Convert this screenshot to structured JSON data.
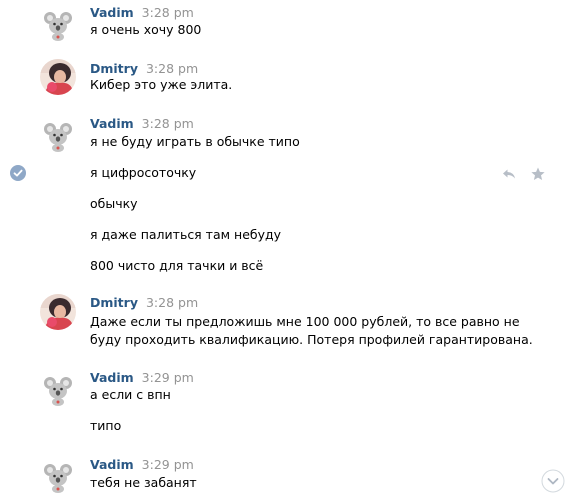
{
  "messages": [
    {
      "author": "Vadim",
      "time": "3:28 pm",
      "avatar": "koala-avatar",
      "lines": [
        "я очень хочу 800"
      ]
    },
    {
      "author": "Dmitry",
      "time": "3:28 pm",
      "avatar": "photo-avatar",
      "lines": [
        "Кибер это уже элита."
      ]
    },
    {
      "author": "Vadim",
      "time": "3:28 pm",
      "avatar": "koala-avatar",
      "lines": [
        "я не буду играть в обычке типо",
        "я цифросоточку",
        "обычку",
        "я даже палиться там небуду",
        "800 чисто для тачки и всё"
      ]
    },
    {
      "author": "Dmitry",
      "time": "3:28 pm",
      "avatar": "photo-avatar",
      "lines": [
        "Даже если ты предложишь мне 100 000 рублей, то все равно не",
        "буду проходить квалификацию. Потеря профилей гарантирована."
      ]
    },
    {
      "author": "Vadim",
      "time": "3:29 pm",
      "avatar": "koala-avatar",
      "lines": [
        "а если с впн",
        "типо"
      ]
    },
    {
      "author": "Vadim",
      "time": "3:29 pm",
      "avatar": "koala-avatar",
      "lines": [
        "тебя не забанят"
      ]
    }
  ],
  "icons": {
    "selected_check": "check-circle-icon",
    "reply": "reply-icon",
    "favorite": "star-icon"
  },
  "colors": {
    "author_name": "#2a5885",
    "timestamp": "#939393",
    "check": "#8fa8c7",
    "action_icons": "#b7bec7"
  }
}
